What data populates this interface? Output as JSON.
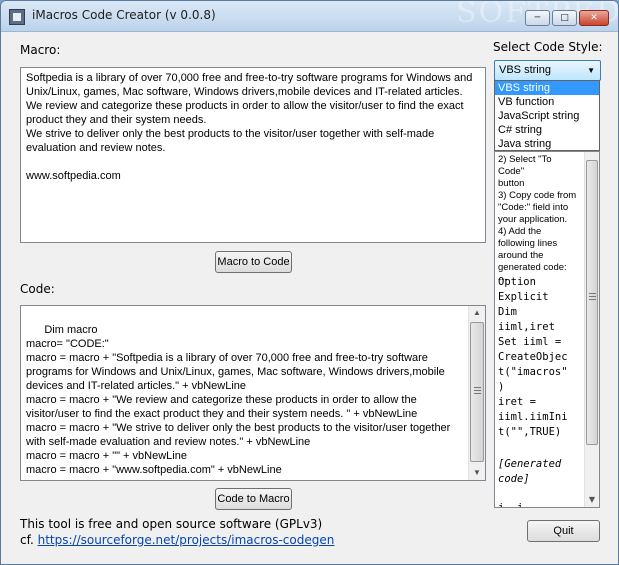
{
  "window": {
    "title": "iMacros Code Creator (v 0.0.8)",
    "watermark": "SOFTPEDIA"
  },
  "labels": {
    "macro": "Macro:",
    "code": "Code:",
    "select_style": "Select Code Style:"
  },
  "macro_text": "Softpedia is a library of over 70,000 free and free-to-try software programs for Windows and Unix/Linux, games, Mac software, Windows drivers,mobile devices and IT-related articles.\nWe review and categorize these products in order to allow the visitor/user to find the exact product they and their system needs.\nWe strive to deliver only the best products to the visitor/user together with self-made evaluation and review notes.\n\nwww.softpedia.com",
  "code_text": "Dim macro\nmacro= \"CODE:\"\nmacro = macro + \"Softpedia is a library of over 70,000 free and free-to-try software programs for Windows and Unix/Linux, games, Mac software, Windows drivers,mobile devices and IT-related articles.\" + vbNewLine\nmacro = macro + \"We review and categorize these products in order to allow the visitor/user to find the exact product they and their system needs. \" + vbNewLine\nmacro = macro + \"We strive to deliver only the best products to the visitor/user together with self-made evaluation and review notes.\" + vbNewLine\nmacro = macro + \"\" + vbNewLine\nmacro = macro + \"www.softpedia.com\" + vbNewLine",
  "buttons": {
    "macro_to_code": "Macro to Code",
    "code_to_macro": "Code to Macro",
    "quit": "Quit"
  },
  "code_style": {
    "selected": "VBS string",
    "options": [
      "VBS string",
      "VB function",
      "JavaScript string",
      "C# string",
      "Java string"
    ]
  },
  "help": {
    "instructions": "2) Select \"To Code\"\nbutton\n3) Copy code from\n\"Code:\" field into\nyour application.\n4) Add the\nfollowing lines\naround the\ngenerated code:\n---",
    "code_lines": "Option\nExplicit\nDim\niiml,iret\nSet iiml =\nCreateObjec\nt(\"imacros\"\n)\niret =\niiml.iimIni\nt(\"\",TRUE)",
    "generated": "[Generated\ncode]",
    "trailing": "i  i"
  },
  "footer": {
    "line1": "This tool is free and open source software (GPLv3)",
    "cf": "cf.",
    "link": "https://sourceforge.net/projects/imacros-codegen"
  },
  "colors": {
    "selection": "#3399ff",
    "link": "#0645ad",
    "titlebar": "#bcd3ec"
  }
}
